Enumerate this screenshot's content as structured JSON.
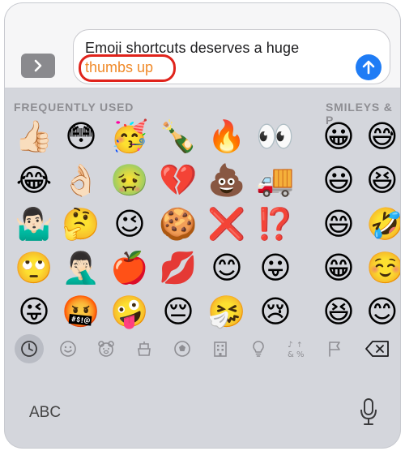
{
  "compose": {
    "message_line1": "Emoji shortcuts deserves a huge",
    "message_line2": "thumbs up",
    "expand_icon": "chevron-right-icon",
    "send_icon": "arrow-up-icon",
    "accent_color": "#1f7cf5",
    "suggestion_color": "#f08a2a",
    "highlight_color": "#e0231b"
  },
  "keyboard": {
    "sections": {
      "frequently_used": "FREQUENTLY USED",
      "smileys": "SMILEYS & P"
    },
    "frequent_emojis": [
      "👍🏻",
      "😳",
      "🥳",
      "🍾",
      "🔥",
      "👀",
      "😂",
      "👌🏻",
      "🤢",
      "💔",
      "💩",
      "🚚",
      "🤷🏻‍♂️",
      "🤔",
      "😉",
      "🍪",
      "❌",
      "⁉️",
      "🙄",
      "🤦🏻‍♂️",
      "🍎",
      "💋",
      "😊",
      "😛",
      "😜",
      "🤬",
      "🤪",
      "😔",
      "🤧",
      "😢"
    ],
    "smiley_emojis": [
      "😀",
      "😅",
      "😃",
      "😆",
      "😄",
      "🤣",
      "😁",
      "☺️",
      "😆",
      "😊"
    ],
    "categories": [
      "clock-icon",
      "smiley-icon",
      "bear-icon",
      "food-icon",
      "ball-icon",
      "building-icon",
      "lightbulb-icon",
      "symbols-icon",
      "flag-icon",
      "backspace-icon"
    ],
    "abc_label": "ABC",
    "mic_icon": "microphone-icon"
  }
}
